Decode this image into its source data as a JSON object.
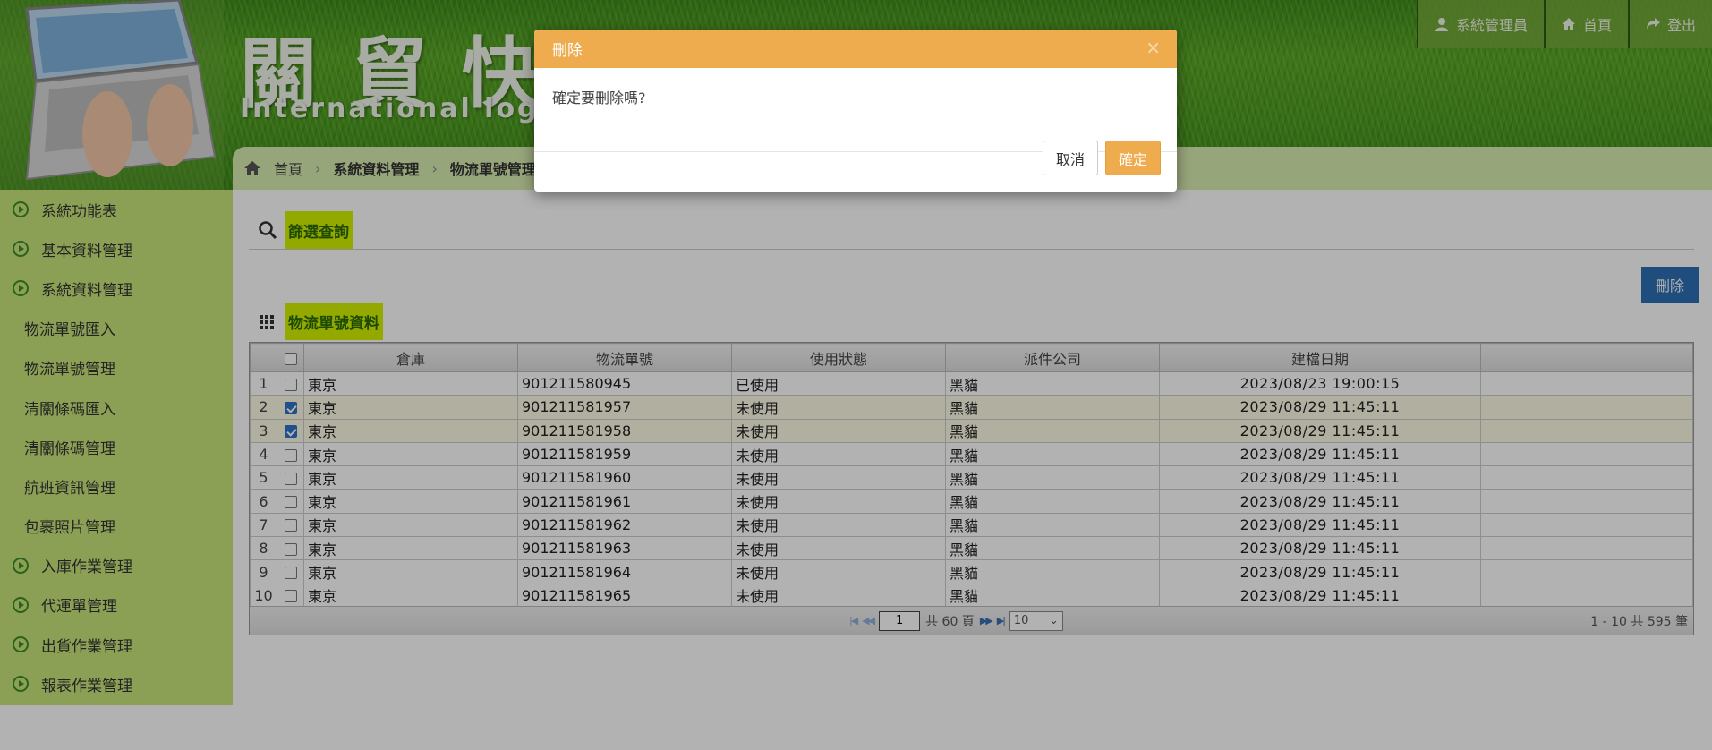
{
  "header": {
    "logo_cn": "關貿快貨運",
    "logo_en": "International logistics",
    "nav": [
      {
        "label": "系統管理員",
        "icon": "user-icon"
      },
      {
        "label": "首頁",
        "icon": "home-icon"
      },
      {
        "label": "登出",
        "icon": "share-icon"
      }
    ]
  },
  "breadcrumb": [
    "首頁",
    "系統資料管理",
    "物流單號管理"
  ],
  "sidebar": {
    "items": [
      {
        "label": "系統功能表",
        "level": "top"
      },
      {
        "label": "基本資料管理",
        "level": "top"
      },
      {
        "label": "系統資料管理",
        "level": "top"
      },
      {
        "label": "物流單號匯入",
        "level": "sub"
      },
      {
        "label": "物流單號管理",
        "level": "sub"
      },
      {
        "label": "清關條碼匯入",
        "level": "sub"
      },
      {
        "label": "清關條碼管理",
        "level": "sub"
      },
      {
        "label": "航班資訊管理",
        "level": "sub"
      },
      {
        "label": "包裹照片管理",
        "level": "sub"
      },
      {
        "label": "入庫作業管理",
        "level": "top"
      },
      {
        "label": "代運單管理",
        "level": "top"
      },
      {
        "label": "出貨作業管理",
        "level": "top"
      },
      {
        "label": "報表作業管理",
        "level": "top"
      }
    ]
  },
  "filter": {
    "title": "篩選查詢"
  },
  "toolbar": {
    "delete_label": "刪除"
  },
  "grid": {
    "title": "物流單號資料",
    "columns": [
      "倉庫",
      "物流單號",
      "使用狀態",
      "派件公司",
      "建檔日期"
    ],
    "rows": [
      {
        "n": "1",
        "checked": false,
        "warehouse": "東京",
        "tracking": "901211580945",
        "status": "已使用",
        "courier": "黑貓",
        "created": "2023/08/23 19:00:15"
      },
      {
        "n": "2",
        "checked": true,
        "warehouse": "東京",
        "tracking": "901211581957",
        "status": "未使用",
        "courier": "黑貓",
        "created": "2023/08/29 11:45:11"
      },
      {
        "n": "3",
        "checked": true,
        "warehouse": "東京",
        "tracking": "901211581958",
        "status": "未使用",
        "courier": "黑貓",
        "created": "2023/08/29 11:45:11"
      },
      {
        "n": "4",
        "checked": false,
        "warehouse": "東京",
        "tracking": "901211581959",
        "status": "未使用",
        "courier": "黑貓",
        "created": "2023/08/29 11:45:11"
      },
      {
        "n": "5",
        "checked": false,
        "warehouse": "東京",
        "tracking": "901211581960",
        "status": "未使用",
        "courier": "黑貓",
        "created": "2023/08/29 11:45:11"
      },
      {
        "n": "6",
        "checked": false,
        "warehouse": "東京",
        "tracking": "901211581961",
        "status": "未使用",
        "courier": "黑貓",
        "created": "2023/08/29 11:45:11"
      },
      {
        "n": "7",
        "checked": false,
        "warehouse": "東京",
        "tracking": "901211581962",
        "status": "未使用",
        "courier": "黑貓",
        "created": "2023/08/29 11:45:11"
      },
      {
        "n": "8",
        "checked": false,
        "warehouse": "東京",
        "tracking": "901211581963",
        "status": "未使用",
        "courier": "黑貓",
        "created": "2023/08/29 11:45:11"
      },
      {
        "n": "9",
        "checked": false,
        "warehouse": "東京",
        "tracking": "901211581964",
        "status": "未使用",
        "courier": "黑貓",
        "created": "2023/08/29 11:45:11"
      },
      {
        "n": "10",
        "checked": false,
        "warehouse": "東京",
        "tracking": "901211581965",
        "status": "未使用",
        "courier": "黑貓",
        "created": "2023/08/29 11:45:11"
      }
    ],
    "pager": {
      "page": "1",
      "total_pages_text": "共 60 頁",
      "page_size": "10",
      "summary": "1 - 10 共 595 筆"
    }
  },
  "modal": {
    "title": "刪除",
    "message": "確定要刪除嗎?",
    "close": "×",
    "cancel_label": "取消",
    "ok_label": "確定"
  },
  "colors": {
    "accent": "#efac4f",
    "sidebar": "#c9e67a",
    "highlight": "#d4f200",
    "delete_button": "#2b6fb5"
  }
}
